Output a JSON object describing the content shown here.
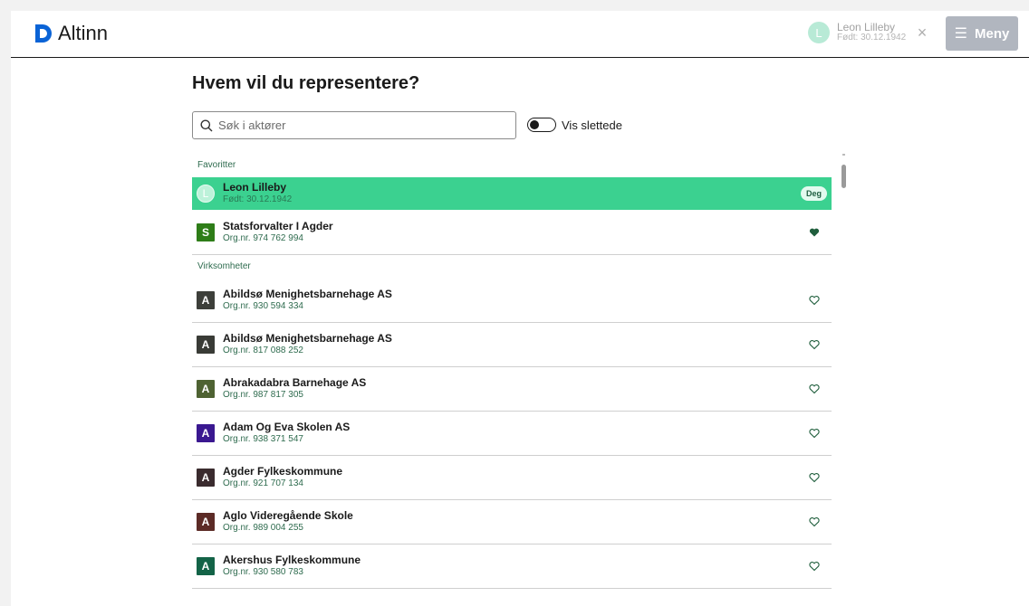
{
  "header": {
    "logo_text": "Altinn",
    "user": {
      "initial": "L",
      "name": "Leon Lilleby",
      "sub": "Født: 30.12.1942"
    },
    "close_glyph": "×",
    "menu_label": "Meny"
  },
  "page": {
    "title": "Hvem vil du representere?",
    "search_placeholder": "Søk i aktører",
    "toggle_label": "Vis slettede"
  },
  "sections": {
    "favorites_label": "Favoritter",
    "companies_label": "Virksomheter"
  },
  "favorites": [
    {
      "initial": "L",
      "name": "Leon Lilleby",
      "sub": "Født: 30.12.1942",
      "tag": "Deg",
      "kind": "person"
    },
    {
      "initial": "S",
      "name": "Statsforvalter I Agder",
      "sub": "Org.nr. 974 762 994",
      "color": "#2e7d18",
      "favorite": true
    }
  ],
  "companies": [
    {
      "initial": "A",
      "name": "Abildsø Menighetsbarnehage AS",
      "sub": "Org.nr. 930 594 334",
      "color": "#3d3f3a",
      "favorite": false
    },
    {
      "initial": "A",
      "name": "Abildsø Menighetsbarnehage AS",
      "sub": "Org.nr. 817 088 252",
      "color": "#393b36",
      "favorite": false
    },
    {
      "initial": "A",
      "name": "Abrakadabra Barnehage AS",
      "sub": "Org.nr. 987 817 305",
      "color": "#4e6232",
      "favorite": false
    },
    {
      "initial": "A",
      "name": "Adam Og Eva Skolen AS",
      "sub": "Org.nr. 938 371 547",
      "color": "#3a1890",
      "favorite": false
    },
    {
      "initial": "A",
      "name": "Agder Fylkeskommune",
      "sub": "Org.nr. 921 707 134",
      "color": "#3a2b2e",
      "favorite": false
    },
    {
      "initial": "A",
      "name": "Aglo Videregående Skole",
      "sub": "Org.nr. 989 004 255",
      "color": "#5c2b26",
      "favorite": false
    },
    {
      "initial": "A",
      "name": "Akershus Fylkeskommune",
      "sub": "Org.nr. 930 580 783",
      "color": "#136347",
      "favorite": false
    }
  ],
  "colors": {
    "accent_active_row": "#3bd190",
    "menu_button": "#b1b6bf",
    "sub_text": "#2e6b4e"
  }
}
